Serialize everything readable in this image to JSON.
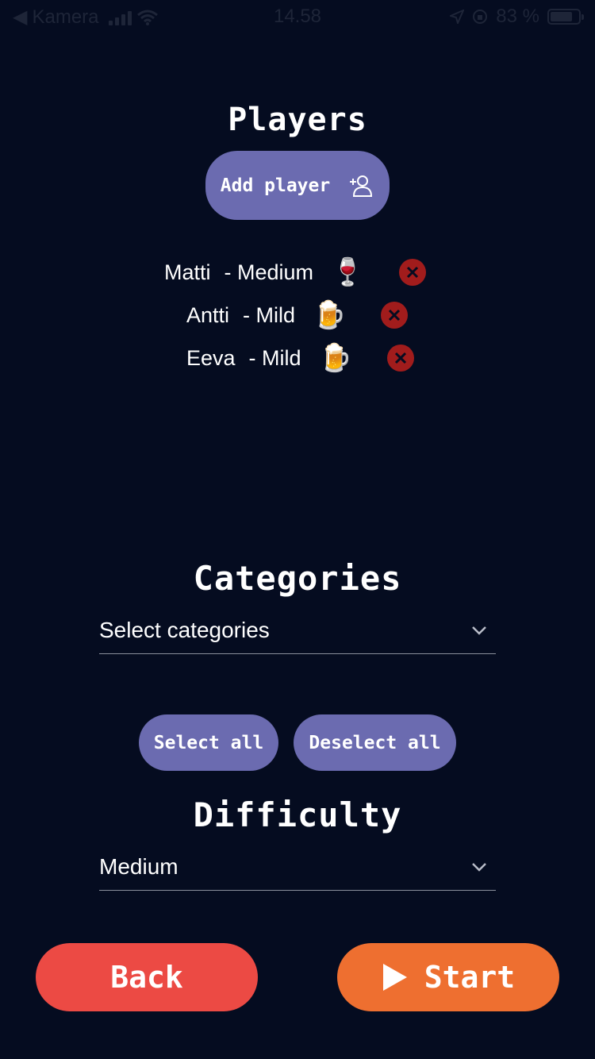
{
  "status_bar": {
    "back_app": "Kamera",
    "time": "14.58",
    "battery_percent": "83 %"
  },
  "players_section": {
    "title": "Players",
    "add_player_label": "Add player",
    "players": [
      {
        "name": "Matti",
        "level": "- Medium",
        "drink": "🍷"
      },
      {
        "name": "Antti",
        "level": "- Mild",
        "drink": "🍺"
      },
      {
        "name": "Eeva",
        "level": "- Mild",
        "drink": "🍺"
      }
    ]
  },
  "categories_section": {
    "title": "Categories",
    "select_placeholder": "Select categories",
    "select_all_label": "Select all",
    "deselect_all_label": "Deselect all"
  },
  "difficulty_section": {
    "title": "Difficulty",
    "selected_value": "Medium"
  },
  "actions": {
    "back_label": "Back",
    "start_label": "Start"
  },
  "colors": {
    "background": "#050c20",
    "pill": "#6b6bb0",
    "back": "#ec4a44",
    "start": "#ee6f30",
    "remove": "#a11c1c"
  }
}
